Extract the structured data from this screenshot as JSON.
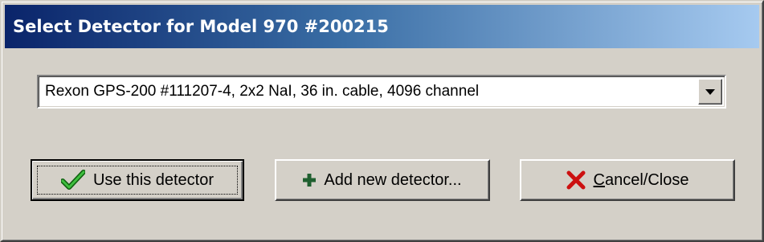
{
  "window": {
    "title": "Select Detector for Model 970 #200215"
  },
  "detector_select": {
    "selected_value": "Rexon GPS-200 #111207-4, 2x2 NaI, 36 in. cable, 4096 channel"
  },
  "buttons": {
    "use_detector": {
      "label": "Use this detector",
      "icon": "checkmark-icon",
      "is_default": true
    },
    "add_detector": {
      "label": "Add new detector...",
      "icon": "plus-icon"
    },
    "cancel": {
      "label_mnemonic": "C",
      "label_rest": "ancel/Close",
      "icon": "red-x-icon"
    }
  },
  "colors": {
    "titlebar_start": "#0a246a",
    "titlebar_end": "#a6caf0",
    "dialog_face": "#d4d0c8",
    "check_green": "#1f8f1f",
    "plus_green": "#1f5f2f",
    "x_red": "#cc1010"
  }
}
